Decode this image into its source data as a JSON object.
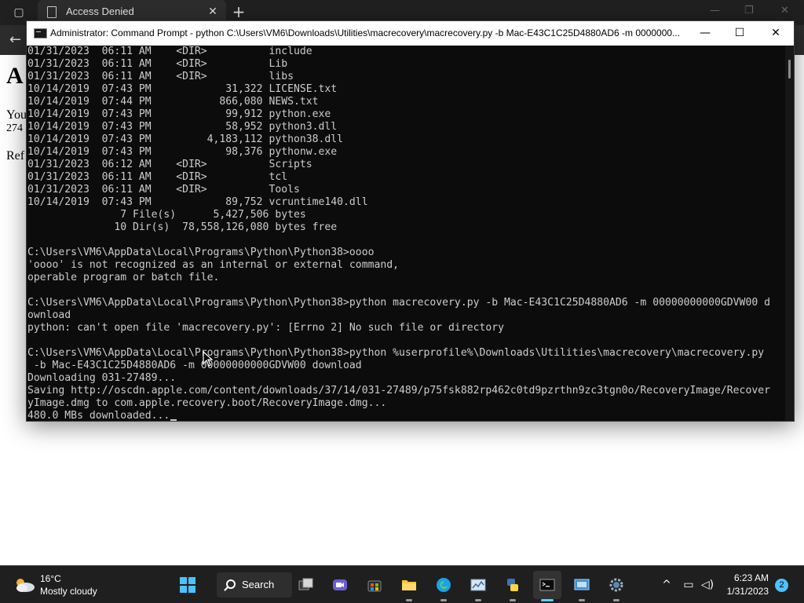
{
  "browser": {
    "tab_title": "Access Denied",
    "page": {
      "heading": "A",
      "text_line1": "You",
      "text_line2": "274",
      "text_line3": "Ref"
    }
  },
  "cmd": {
    "title": "Administrator:  Command Prompt - python  C:\\Users\\VM6\\Downloads\\Utilities\\macrecovery\\macrecovery.py -b Mac-E43C1C25D4880AD6 -m 0000000...",
    "lines": [
      "01/31/2023  06:11 AM    <DIR>          include",
      "01/31/2023  06:11 AM    <DIR>          Lib",
      "01/31/2023  06:11 AM    <DIR>          libs",
      "10/14/2019  07:43 PM            31,322 LICENSE.txt",
      "10/14/2019  07:44 PM           866,080 NEWS.txt",
      "10/14/2019  07:43 PM            99,912 python.exe",
      "10/14/2019  07:43 PM            58,952 python3.dll",
      "10/14/2019  07:43 PM         4,183,112 python38.dll",
      "10/14/2019  07:43 PM            98,376 pythonw.exe",
      "01/31/2023  06:12 AM    <DIR>          Scripts",
      "01/31/2023  06:11 AM    <DIR>          tcl",
      "01/31/2023  06:11 AM    <DIR>          Tools",
      "10/14/2019  07:43 PM            89,752 vcruntime140.dll",
      "               7 File(s)      5,427,506 bytes",
      "              10 Dir(s)  78,558,126,080 bytes free",
      "",
      "C:\\Users\\VM6\\AppData\\Local\\Programs\\Python\\Python38>oooo",
      "'oooo' is not recognized as an internal or external command,",
      "operable program or batch file.",
      "",
      "C:\\Users\\VM6\\AppData\\Local\\Programs\\Python\\Python38>python macrecovery.py -b Mac-E43C1C25D4880AD6 -m 00000000000GDVW00 d",
      "ownload",
      "python: can't open file 'macrecovery.py': [Errno 2] No such file or directory",
      "",
      "C:\\Users\\VM6\\AppData\\Local\\Programs\\Python\\Python38>python %userprofile%\\Downloads\\Utilities\\macrecovery\\macrecovery.py",
      " -b Mac-E43C1C25D4880AD6 -m 00000000000GDVW00 download",
      "Downloading 031-27489...",
      "Saving http://oscdn.apple.com/content/downloads/37/14/031-27489/p75fsk882rp462c0td9pzrthn9zc3tgn0o/RecoveryImage/Recover",
      "yImage.dmg to com.apple.recovery.boot/RecoveryImage.dmg...",
      "480.0 MBs downloaded..."
    ]
  },
  "taskbar": {
    "weather_temp": "16°C",
    "weather_condition": "Mostly cloudy",
    "search_label": "Search",
    "time": "6:23 AM",
    "date": "1/31/2023",
    "notification_count": "2"
  }
}
